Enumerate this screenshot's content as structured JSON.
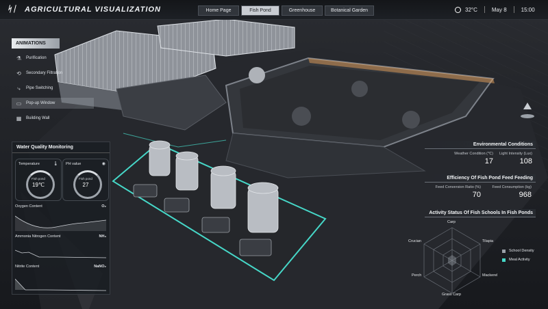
{
  "header": {
    "logo": "ᛋᛁ",
    "title": "AGRICULTURAL VISUALIZATION",
    "tabs": [
      {
        "label": "Home Page",
        "active": false
      },
      {
        "label": "Fish Pond",
        "active": true
      },
      {
        "label": "Greenhouse",
        "active": false
      },
      {
        "label": "Botanical Garden",
        "active": false
      }
    ],
    "temperature": "32°C",
    "date": "May 8",
    "time": "15:00"
  },
  "animations": {
    "title": "ANIMATIONS",
    "items": [
      {
        "label": "Purification",
        "icon": "flask-icon"
      },
      {
        "label": "Secondary Filtration",
        "icon": "filter-icon"
      },
      {
        "label": "Pipe Switching",
        "icon": "pipe-icon"
      },
      {
        "label": "Pop-up Window",
        "icon": "window-icon"
      },
      {
        "label": "Building Wall",
        "icon": "wall-icon"
      }
    ]
  },
  "water_quality": {
    "title": "Water Quality Monitoring",
    "temperature": {
      "label": "Temperature",
      "sub": "Fish pond",
      "value": "19℃"
    },
    "ph": {
      "label": "PH value",
      "sub": "Fish pond",
      "value": "27"
    },
    "oxygen": {
      "label": "Oxygen Content",
      "unit": "O₂"
    },
    "ammonia": {
      "label": "Ammonia Nitrogen Content",
      "unit": "NH₃"
    },
    "nitrite": {
      "label": "Nitrite Content",
      "unit": "NaNO₂"
    }
  },
  "environment": {
    "title": "Environmental Conditions",
    "weather_label": "Weather Condition (℃)",
    "weather_value": "17",
    "light_label": "Light Intensity (Lux)",
    "light_value": "108"
  },
  "feed": {
    "title": "Efficiency Of Fish Pond Feed Feeding",
    "conversion_label": "Feed Conversion Ratio (%)",
    "conversion_value": "70",
    "consumption_label": "Feed Consumption (kg)",
    "consumption_value": "968"
  },
  "activity": {
    "title": "Activity Status Of Fish Schools In Fish Ponds",
    "axes": [
      "Carp",
      "Tilapia",
      "Mackerel",
      "Grass Carp",
      "Perch",
      "Crucian"
    ],
    "legend": [
      {
        "label": "School Density",
        "color": "#9aa0a8"
      },
      {
        "label": "Meal Activity",
        "color": "#46d8c8"
      }
    ]
  },
  "colors": {
    "accent": "#46d8c8",
    "panel": "#1a1d22",
    "orange": "#e8a15a"
  }
}
